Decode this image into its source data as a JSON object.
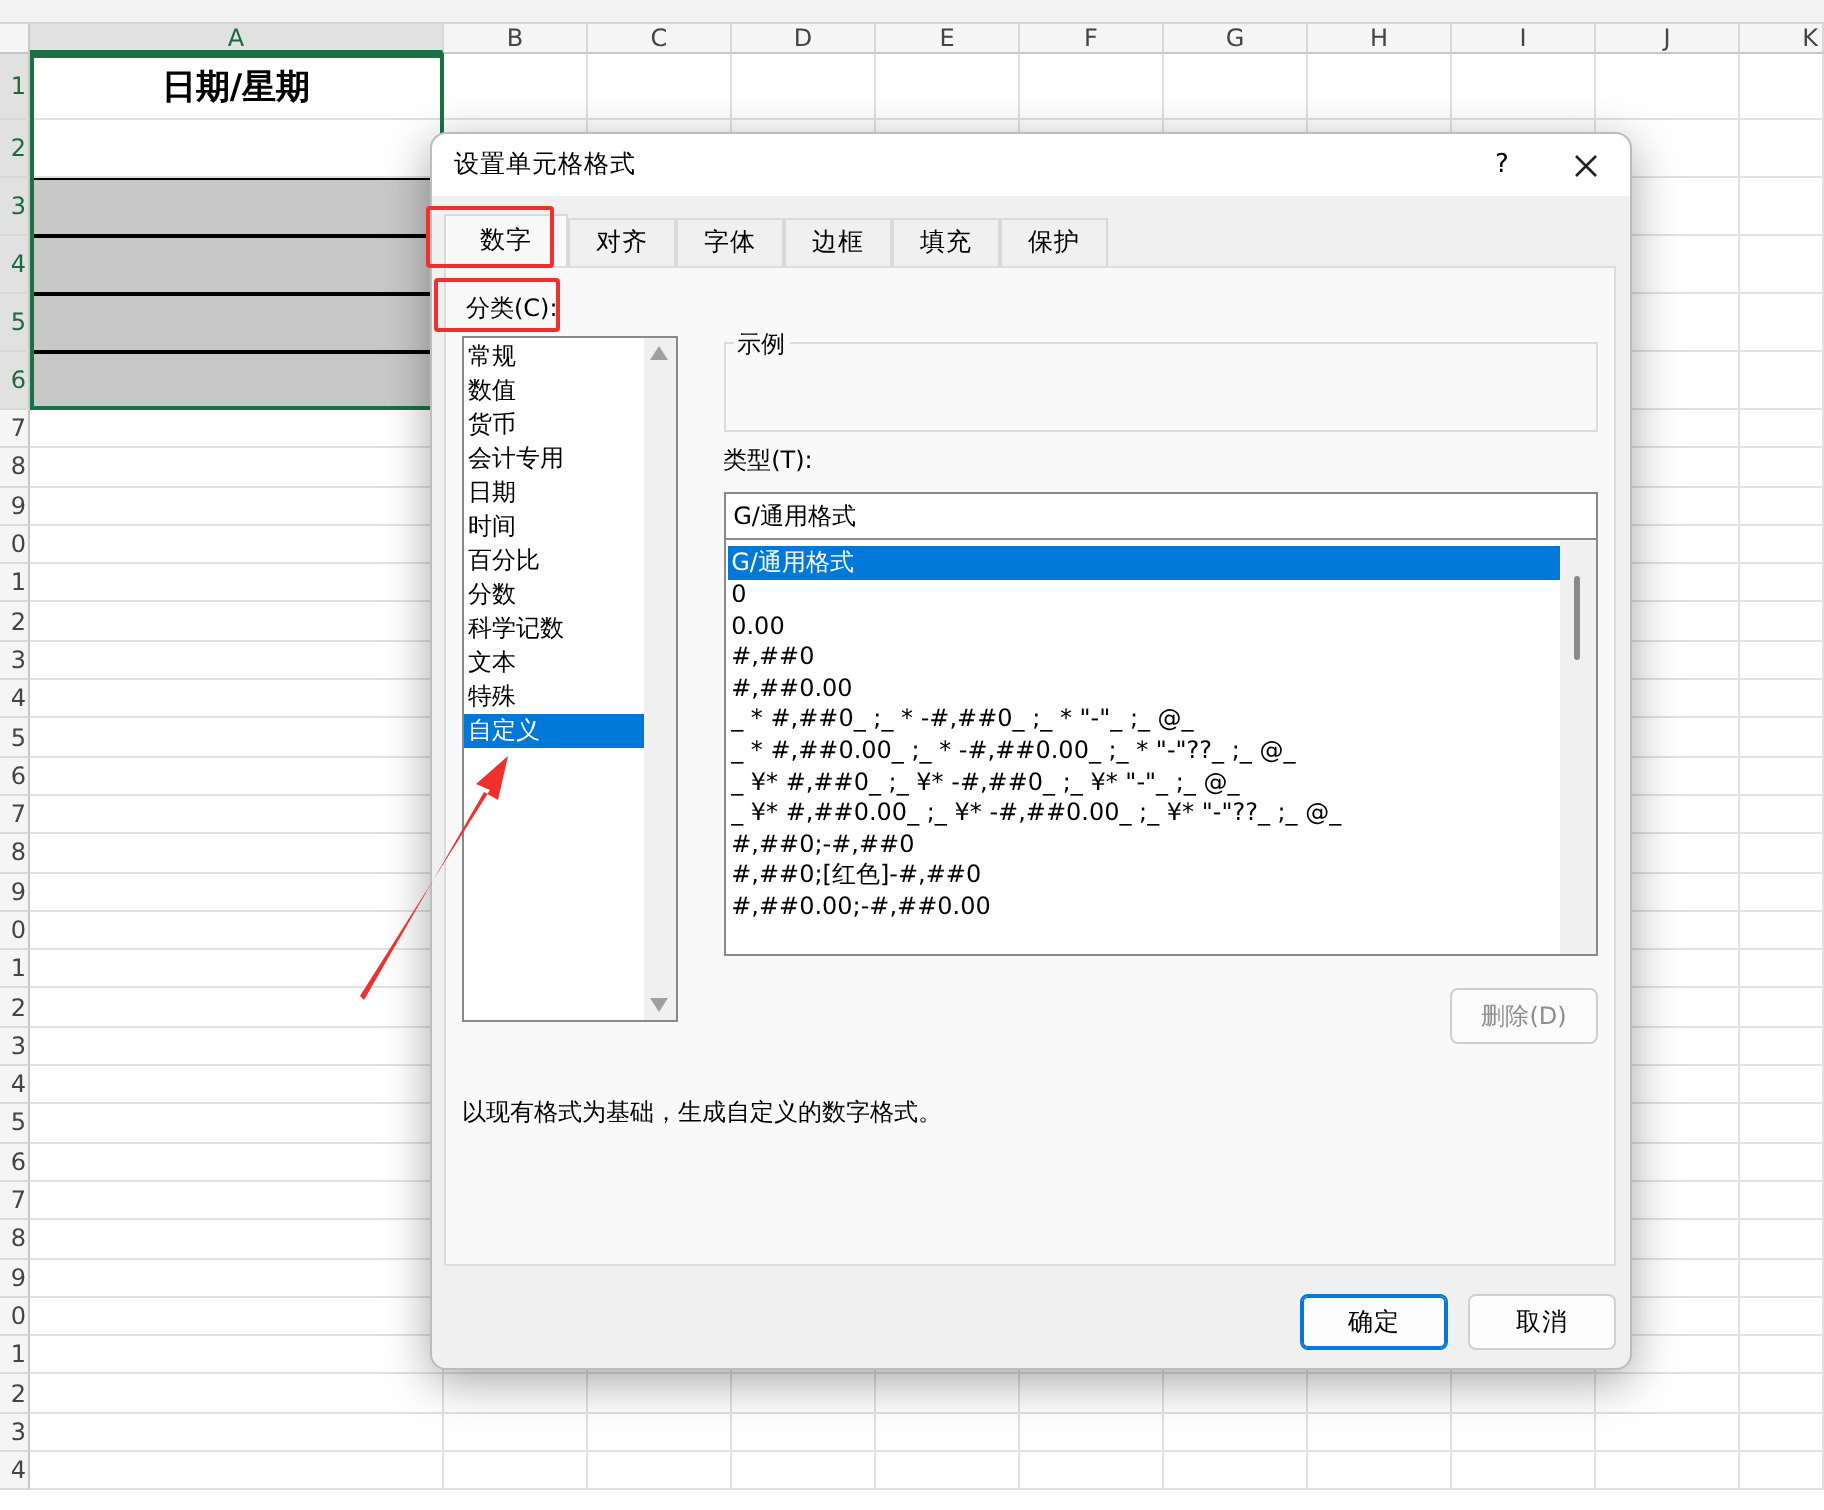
{
  "sheet": {
    "columns": [
      {
        "label": "A",
        "selected": true
      },
      {
        "label": "B",
        "selected": false
      },
      {
        "label": "C",
        "selected": false
      },
      {
        "label": "D",
        "selected": false
      },
      {
        "label": "E",
        "selected": false
      },
      {
        "label": "F",
        "selected": false
      },
      {
        "label": "G",
        "selected": false
      },
      {
        "label": "H",
        "selected": false
      },
      {
        "label": "I",
        "selected": false
      },
      {
        "label": "J",
        "selected": false
      },
      {
        "label": "K",
        "selected": false
      }
    ],
    "rows": [
      {
        "header": "1",
        "value": "日期/星期",
        "shaded": false
      },
      {
        "header": "2",
        "shaded": false
      },
      {
        "header": "3",
        "shaded": true
      },
      {
        "header": "4",
        "shaded": true
      },
      {
        "header": "5",
        "shaded": true
      },
      {
        "header": "6",
        "shaded": true
      },
      {
        "header": "7",
        "shaded": false
      },
      {
        "header": "8",
        "shaded": false
      },
      {
        "header": "9",
        "shaded": false
      },
      {
        "header": "0",
        "shaded": false
      },
      {
        "header": "1",
        "shaded": false
      },
      {
        "header": "2",
        "shaded": false
      },
      {
        "header": "3",
        "shaded": false
      },
      {
        "header": "4",
        "shaded": false
      },
      {
        "header": "5",
        "shaded": false
      },
      {
        "header": "6",
        "shaded": false
      },
      {
        "header": "7",
        "shaded": false
      },
      {
        "header": "8",
        "shaded": false
      },
      {
        "header": "9",
        "shaded": false
      },
      {
        "header": "0",
        "shaded": false
      },
      {
        "header": "1",
        "shaded": false
      },
      {
        "header": "2",
        "shaded": false
      },
      {
        "header": "3",
        "shaded": false
      },
      {
        "header": "4",
        "shaded": false
      },
      {
        "header": "5",
        "shaded": false
      },
      {
        "header": "6",
        "shaded": false
      },
      {
        "header": "7",
        "shaded": false
      },
      {
        "header": "8",
        "shaded": false
      },
      {
        "header": "9",
        "shaded": false
      },
      {
        "header": "0",
        "shaded": false
      },
      {
        "header": "1",
        "shaded": false
      },
      {
        "header": "2",
        "shaded": false
      },
      {
        "header": "3",
        "shaded": false
      },
      {
        "header": "4",
        "shaded": false
      }
    ]
  },
  "dialog": {
    "title": "设置单元格格式",
    "help": "?",
    "tabs": [
      {
        "label": "数字",
        "selected": true
      },
      {
        "label": "对齐",
        "selected": false
      },
      {
        "label": "字体",
        "selected": false
      },
      {
        "label": "边框",
        "selected": false
      },
      {
        "label": "填充",
        "selected": false
      },
      {
        "label": "保护",
        "selected": false
      }
    ],
    "category_label": "分类(C):",
    "categories": [
      {
        "label": "常规",
        "selected": false
      },
      {
        "label": "数值",
        "selected": false
      },
      {
        "label": "货币",
        "selected": false
      },
      {
        "label": "会计专用",
        "selected": false
      },
      {
        "label": "日期",
        "selected": false
      },
      {
        "label": "时间",
        "selected": false
      },
      {
        "label": "百分比",
        "selected": false
      },
      {
        "label": "分数",
        "selected": false
      },
      {
        "label": "科学记数",
        "selected": false
      },
      {
        "label": "文本",
        "selected": false
      },
      {
        "label": "特殊",
        "selected": false
      },
      {
        "label": "自定义",
        "selected": true
      }
    ],
    "sample_label": "示例",
    "type_label": "类型(T):",
    "type_value": "G/通用格式",
    "formats": [
      {
        "label": "G/通用格式",
        "selected": true
      },
      {
        "label": "0",
        "selected": false
      },
      {
        "label": "0.00",
        "selected": false
      },
      {
        "label": "#,##0",
        "selected": false
      },
      {
        "label": "#,##0.00",
        "selected": false
      },
      {
        "label": "_ * #,##0_ ;_ * -#,##0_ ;_ * \"-\"_ ;_ @_",
        "selected": false
      },
      {
        "label": "_ * #,##0.00_ ;_ * -#,##0.00_ ;_ * \"-\"??_ ;_ @_",
        "selected": false
      },
      {
        "label": "_ ¥* #,##0_ ;_ ¥* -#,##0_ ;_ ¥* \"-\"_ ;_ @_",
        "selected": false
      },
      {
        "label": "_ ¥* #,##0.00_ ;_ ¥* -#,##0.00_ ;_ ¥* \"-\"??_ ;_ @_",
        "selected": false
      },
      {
        "label": "#,##0;-#,##0",
        "selected": false
      },
      {
        "label": "#,##0;[红色]-#,##0",
        "selected": false
      },
      {
        "label": "#,##0.00;-#,##0.00",
        "selected": false
      }
    ],
    "delete_button": {
      "label": "删除(D)",
      "disabled": true
    },
    "description": "以现有格式为基础，生成自定义的数字格式。",
    "ok_button": "确定",
    "cancel_button": "取消"
  }
}
